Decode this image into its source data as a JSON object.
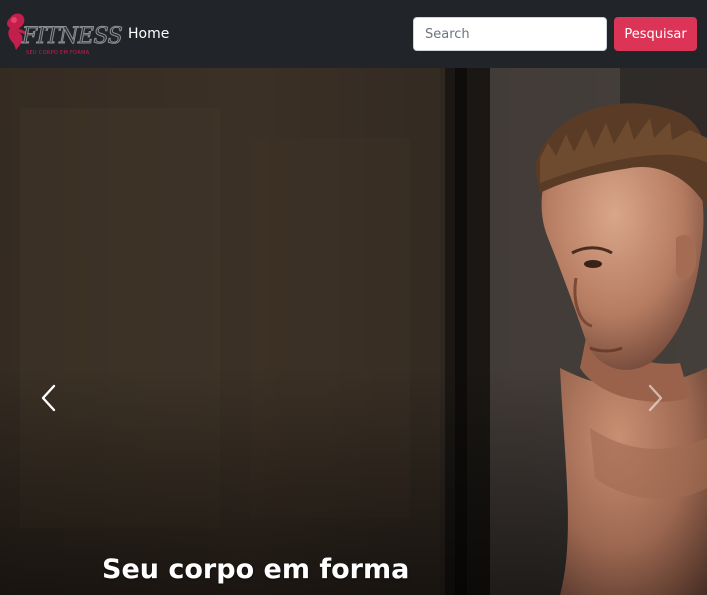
{
  "brand": {
    "name": "FITNESS",
    "tagline": "SEU CORPO EM FORMA",
    "accent_color": "#dc3457"
  },
  "nav": {
    "home_label": "Home"
  },
  "search": {
    "placeholder": "Search",
    "button_label": "Pesquisar"
  },
  "carousel": {
    "slide_caption": "Seu corpo em forma",
    "prev_icon": "chevron-left-icon",
    "next_icon": "chevron-right-icon"
  },
  "colors": {
    "navbar_bg": "#212529",
    "button_bg": "#dc3457"
  }
}
